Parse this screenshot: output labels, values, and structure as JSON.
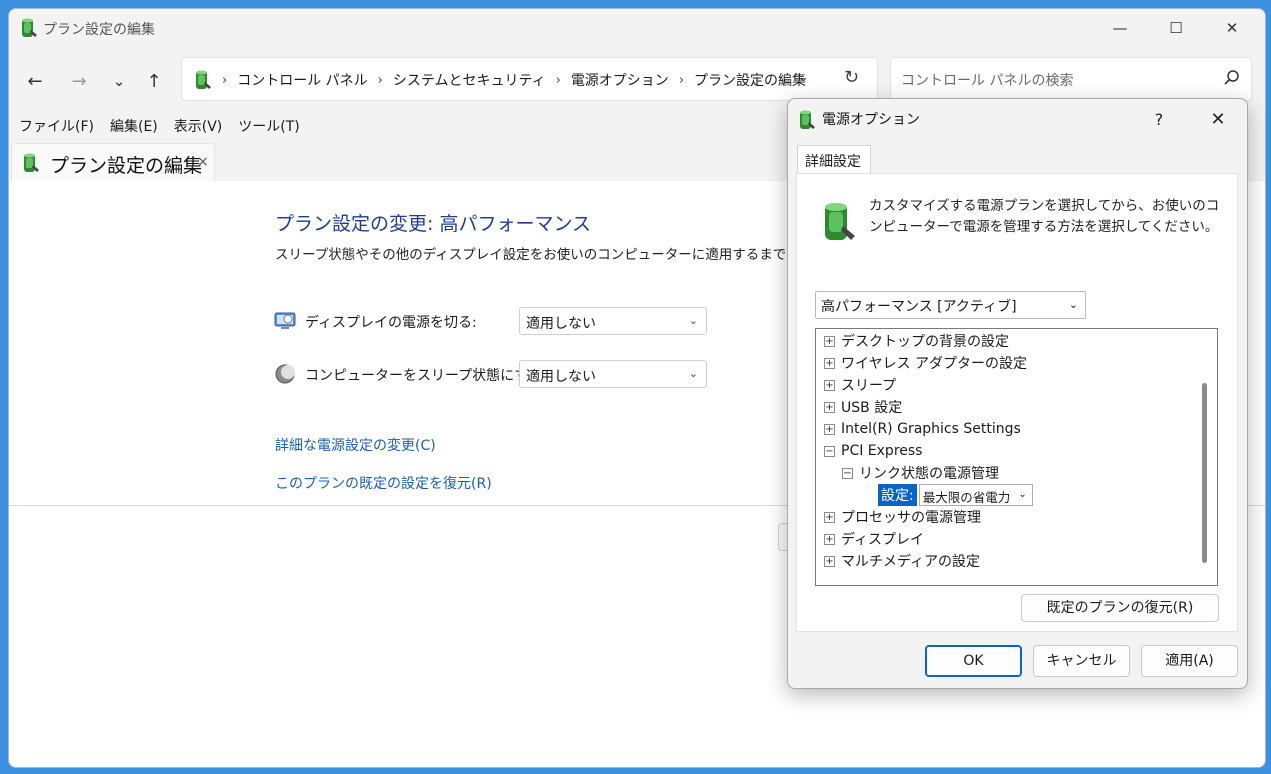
{
  "window": {
    "title": "プラン設定の編集",
    "controls": {
      "minimize": "—",
      "maximize": "☐",
      "close": "✕"
    }
  },
  "nav": {
    "back_icon": "←",
    "forward_icon": "→",
    "recent_icon": "⌄",
    "up_icon": "↑",
    "breadcrumbs": [
      "コントロール パネル",
      "システムとセキュリティ",
      "電源オプション",
      "プラン設定の編集"
    ],
    "separator": "›",
    "dropdown_icon": "⌄",
    "refresh_icon": "↻"
  },
  "search": {
    "placeholder": "コントロール パネルの検索"
  },
  "menubar": [
    "ファイル(F)",
    "編集(E)",
    "表示(V)",
    "ツール(T)"
  ],
  "tab": {
    "label": "プラン設定の編集",
    "close": "×"
  },
  "content": {
    "heading": "プラン設定の変更: 高パフォーマンス",
    "description": "スリープ状態やその他のディスプレイ設定をお使いのコンピューターに適用するまでの時間を指定してください。",
    "display_off_label": "ディスプレイの電源を切る:",
    "display_off_value": "適用しない",
    "sleep_label": "コンピューターをスリープ状態にする:",
    "sleep_value": "適用しない",
    "advanced_link": "詳細な電源設定の変更(C)",
    "restore_link": "このプランの既定の設定を復元(R)"
  },
  "dialog": {
    "title": "電源オプション",
    "help": "?",
    "close": "✕",
    "tab": "詳細設定",
    "intro": "カスタマイズする電源プランを選択してから、お使いのコンピューターで電源を管理する方法を選択してください。",
    "plan": "高パフォーマンス [アクティブ]",
    "tree": [
      {
        "label": "デスクトップの背景の設定",
        "exp": "+"
      },
      {
        "label": "ワイヤレス アダプターの設定",
        "exp": "+"
      },
      {
        "label": "スリープ",
        "exp": "+"
      },
      {
        "label": "USB 設定",
        "exp": "+"
      },
      {
        "label": "Intel(R) Graphics Settings",
        "exp": "+"
      },
      {
        "label": "PCI Express",
        "exp": "−"
      },
      {
        "label": "リンク状態の電源管理",
        "exp": "−"
      },
      {
        "setting_label": "設定:",
        "setting_value": "最大限の省電力"
      },
      {
        "label": "プロセッサの電源管理",
        "exp": "+"
      },
      {
        "label": "ディスプレイ",
        "exp": "+"
      },
      {
        "label": "マルチメディアの設定",
        "exp": "+"
      }
    ],
    "restore_button": "既定のプランの復元(R)",
    "ok": "OK",
    "cancel": "キャンセル",
    "apply": "適用(A)"
  },
  "chevron": "⌄",
  "colors": {
    "accent": "#0a64c8",
    "link": "#1a5fb4",
    "heading": "#1e3f8f",
    "desktop": "#3d8fe0"
  }
}
